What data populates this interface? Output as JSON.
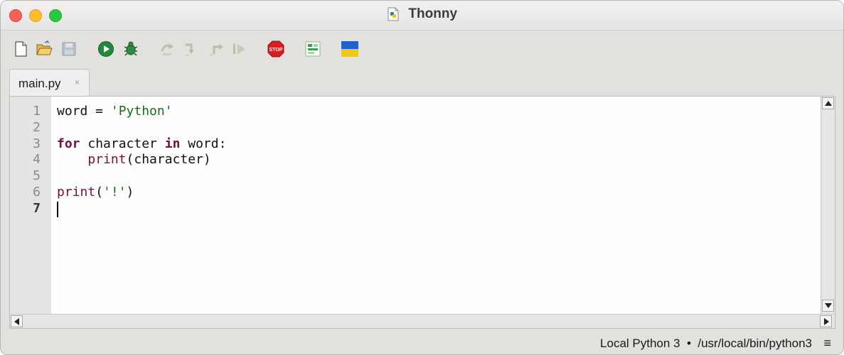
{
  "window": {
    "title": "Thonny"
  },
  "toolbar": {
    "buttons": [
      {
        "name": "new-file-icon",
        "enabled": true
      },
      {
        "name": "open-folder-icon",
        "enabled": true
      },
      {
        "name": "save-icon",
        "enabled": false
      },
      {
        "name": "run-icon",
        "enabled": true
      },
      {
        "name": "debug-bug-icon",
        "enabled": true
      },
      {
        "name": "step-over-icon",
        "enabled": false
      },
      {
        "name": "step-into-icon",
        "enabled": false
      },
      {
        "name": "step-out-icon",
        "enabled": false
      },
      {
        "name": "resume-icon",
        "enabled": false
      },
      {
        "name": "stop-icon",
        "enabled": true,
        "label": "STOP"
      },
      {
        "name": "support-icon",
        "enabled": true
      },
      {
        "name": "ukraine-flag-icon",
        "enabled": true
      }
    ],
    "colors": {
      "run": "#1f8a3b",
      "stop": "#d32020",
      "flag_top": "#1f5fd1",
      "flag_bottom": "#f2c813"
    }
  },
  "tabs": [
    {
      "label": "main.py",
      "close": "×",
      "active": true
    }
  ],
  "editor": {
    "line_numbers": [
      "1",
      "2",
      "3",
      "4",
      "5",
      "6",
      "7"
    ],
    "active_line": "7",
    "lines": [
      [
        {
          "t": "word = ",
          "c": "plain"
        },
        {
          "t": "'Python'",
          "c": "str"
        }
      ],
      [],
      [
        {
          "t": "for",
          "c": "kw"
        },
        {
          "t": " character ",
          "c": "plain"
        },
        {
          "t": "in",
          "c": "kw"
        },
        {
          "t": " word:",
          "c": "plain"
        }
      ],
      [
        {
          "t": "    ",
          "c": "plain"
        },
        {
          "t": "print",
          "c": "bi"
        },
        {
          "t": "(character)",
          "c": "plain"
        }
      ],
      [],
      [
        {
          "t": "print",
          "c": "bi"
        },
        {
          "t": "(",
          "c": "plain"
        },
        {
          "t": "'!'",
          "c": "str"
        },
        {
          "t": ")",
          "c": "plain"
        }
      ],
      []
    ]
  },
  "statusbar": {
    "interpreter": "Local Python 3  •  /usr/local/bin/python3",
    "menu_glyph": "≡"
  }
}
